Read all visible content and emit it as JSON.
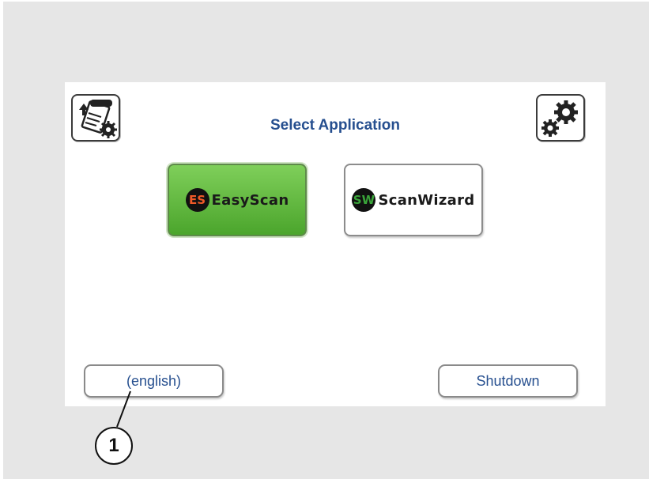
{
  "screen": {
    "title": "Select Application",
    "scan_settings_button": {
      "icon": "scanner-settings-icon"
    },
    "system_settings_button": {
      "icon": "gears-icon"
    }
  },
  "applications": [
    {
      "label": "EasyScan",
      "logo_text": "ES",
      "selected": true,
      "color": "#5cb83a"
    },
    {
      "label": "ScanWizard",
      "logo_text": "SW",
      "selected": false,
      "color": "#ffffff"
    }
  ],
  "footer": {
    "language_label": "(english)",
    "shutdown_label": "Shutdown"
  },
  "callout": {
    "number": "1"
  },
  "colors": {
    "accent_text": "#264f8f",
    "selected_app": "#5cb83a",
    "logo_red": "#f05a28",
    "logo_green": "#3aa53a"
  }
}
